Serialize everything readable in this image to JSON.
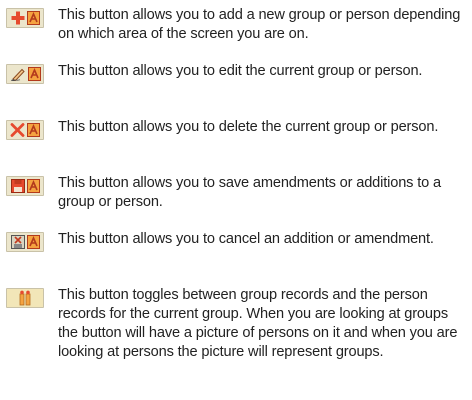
{
  "colors": {
    "button_face": "#ece6cc",
    "button_face_alt": "#f2e6b8",
    "accent_red": "#e64a2e",
    "accent_orange": "#f5a340",
    "text": "#222222"
  },
  "items": [
    {
      "icon": "add-person-icon",
      "description": "This button allows you to add a new group or person depending on which area of the screen you are on."
    },
    {
      "icon": "edit-person-icon",
      "description": "This button allows you to edit the current group or person."
    },
    {
      "icon": "delete-person-icon",
      "description": "This button allows you to delete the current group or person."
    },
    {
      "icon": "save-person-icon",
      "description": "This button allows you to save amendments or additions to a group or person."
    },
    {
      "icon": "cancel-person-icon",
      "description": "This button allows you to cancel an addition or amendment."
    },
    {
      "icon": "toggle-groups-icon",
      "description": "This button toggles between group records and the person records for the current group. When you are looking at groups the button will have a picture of persons on it and when you are looking at persons the picture will represent groups."
    }
  ]
}
